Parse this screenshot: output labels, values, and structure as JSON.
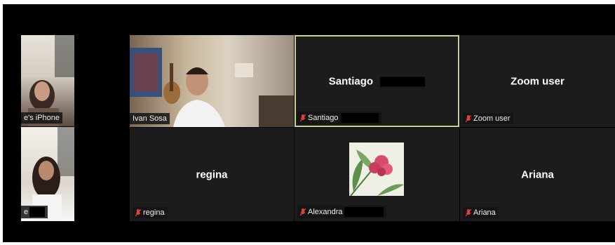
{
  "participants": [
    {
      "display": "",
      "label": "e's iPhone",
      "muted": false,
      "kind": "video"
    },
    {
      "display": "",
      "label": "e",
      "muted": false,
      "kind": "video"
    },
    {
      "display": "",
      "label": "Ivan Sosa",
      "muted": false,
      "kind": "video"
    },
    {
      "display": "Santiago",
      "label": "Santiago",
      "muted": true,
      "kind": "name",
      "active": true
    },
    {
      "display": "Zoom user",
      "label": "Zoom user",
      "muted": true,
      "kind": "name"
    },
    {
      "display": "regina",
      "label": "regina",
      "muted": true,
      "kind": "name"
    },
    {
      "display": "",
      "label": "Alexandra",
      "muted": true,
      "kind": "avatar"
    },
    {
      "display": "Ariana",
      "label": "Ariana",
      "muted": true,
      "kind": "name"
    }
  ],
  "colors": {
    "active_border": "#c9d28a",
    "muted_icon": "#e0403a",
    "tile_bg": "#1a1a1a"
  },
  "icons": {
    "muted": "microphone-muted-icon"
  }
}
